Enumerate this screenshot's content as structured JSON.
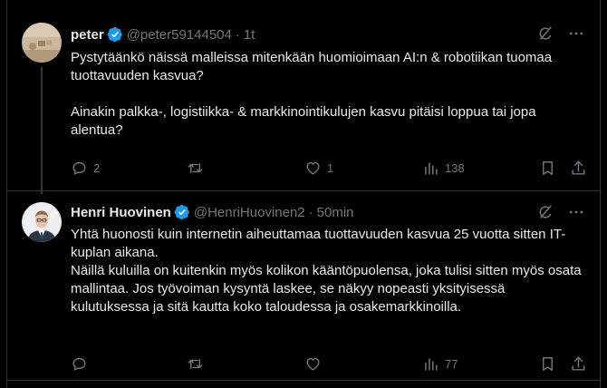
{
  "tweets": [
    {
      "author": {
        "name": "peter",
        "handle": "@peter59144504",
        "verified": true
      },
      "time": "1t",
      "paragraphs": [
        "Pystytäänkö näissä malleissa mitenkään huomioimaan AI:n & robotiikan tuomaa tuottavuuden kasvua?",
        "Ainakin palkka-, logistiikka- & markkinointikulujen kasvu pitäisi loppua tai jopa alentua?"
      ],
      "stats": {
        "replies": "2",
        "retweets": "",
        "likes": "1",
        "views": "138"
      }
    },
    {
      "author": {
        "name": "Henri Huovinen",
        "handle": "@HenriHuovinen2",
        "verified": true
      },
      "time": "50min",
      "paragraphs": [
        "Yhtä huonosti kuin internetin aiheuttamaa tuottavuuden kasvua 25 vuotta sitten IT-kuplan aikana.",
        "Näillä kuluilla on kuitenkin myös kolikon kääntöpuolensa, joka tulisi sitten myös osata mallintaa. Jos työvoiman kysyntä laskee, se näkyy nopeasti yksityisessä kulutuksessa ja sitä kautta koko taloudessa ja osakemarkkinoilla."
      ],
      "stats": {
        "replies": "",
        "retweets": "",
        "likes": "",
        "views": "77"
      }
    }
  ],
  "separator": "·",
  "icons": {
    "reply": "reply-icon",
    "retweet": "retweet-icon",
    "like": "heart-icon",
    "views": "views-icon",
    "bookmark": "bookmark-icon",
    "share": "share-icon",
    "grok": "grok-icon",
    "more": "more-icon",
    "verified": "verified-badge-icon"
  },
  "colors": {
    "background": "#000000",
    "text": "#e7e9ea",
    "muted": "#71767b",
    "verified": "#1d9bf0",
    "border": "#2f3336"
  }
}
